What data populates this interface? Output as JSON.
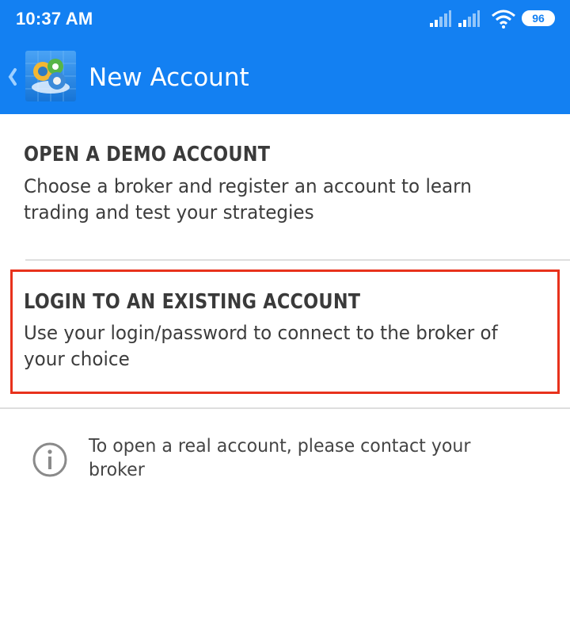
{
  "status_bar": {
    "time": "10:37 AM",
    "battery_level": "96",
    "icons": [
      "signal-icon",
      "signal-icon",
      "wifi-icon",
      "battery-icon"
    ]
  },
  "app_bar": {
    "title": "New Account",
    "back_icon": "chevron-left-icon",
    "logo_icon": "metatrader-logo-icon"
  },
  "options": [
    {
      "title": "OPEN A DEMO ACCOUNT",
      "description": "Choose a broker and register an account to learn trading and test your strategies"
    },
    {
      "title": "LOGIN TO AN EXISTING ACCOUNT",
      "description": "Use your login/password to connect to the broker of your choice",
      "highlighted": true
    }
  ],
  "info": {
    "icon": "info-icon",
    "text": "To open a real account, please contact your broker"
  },
  "colors": {
    "primary": "#1380f2",
    "highlight_border": "#e8321c",
    "divider": "#dedede"
  }
}
